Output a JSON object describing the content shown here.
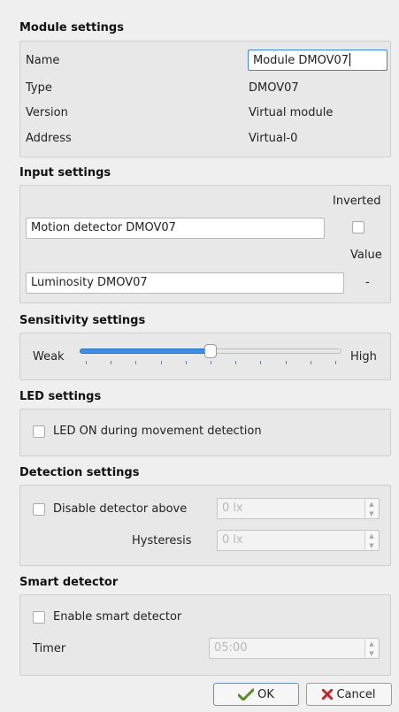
{
  "module_settings": {
    "title": "Module settings",
    "name_label": "Name",
    "name_value": "Module DMOV07",
    "type_label": "Type",
    "type_value": "DMOV07",
    "version_label": "Version",
    "version_value": "Virtual module",
    "address_label": "Address",
    "address_value": "Virtual-0"
  },
  "input_settings": {
    "title": "Input settings",
    "inverted_label": "Inverted",
    "motion_value": "Motion detector DMOV07",
    "value_label": "Value",
    "luminosity_value": "Luminosity DMOV07",
    "luminosity_reading": "-"
  },
  "sensitivity_settings": {
    "title": "Sensitivity settings",
    "min_label": "Weak",
    "max_label": "High",
    "level_fraction": 0.5,
    "tick_count": 11
  },
  "led_settings": {
    "title": "LED settings",
    "checkbox_label": "LED ON during movement detection"
  },
  "detection_settings": {
    "title": "Detection settings",
    "disable_label": "Disable detector above",
    "disable_value": "0 lx",
    "hysteresis_label": "Hysteresis",
    "hysteresis_value": "0 lx"
  },
  "smart_detector": {
    "title": "Smart detector",
    "enable_label": "Enable smart detector",
    "timer_label": "Timer",
    "timer_value": "05:00"
  },
  "buttons": {
    "ok_label": "OK",
    "cancel_label": "Cancel"
  },
  "colors": {
    "accent": "#3d8ee6",
    "ok_icon": "#5a8a2a",
    "cancel_icon": "#c0282d"
  },
  "icons": {
    "ok": "ok-check-icon",
    "cancel": "cancel-x-icon"
  }
}
